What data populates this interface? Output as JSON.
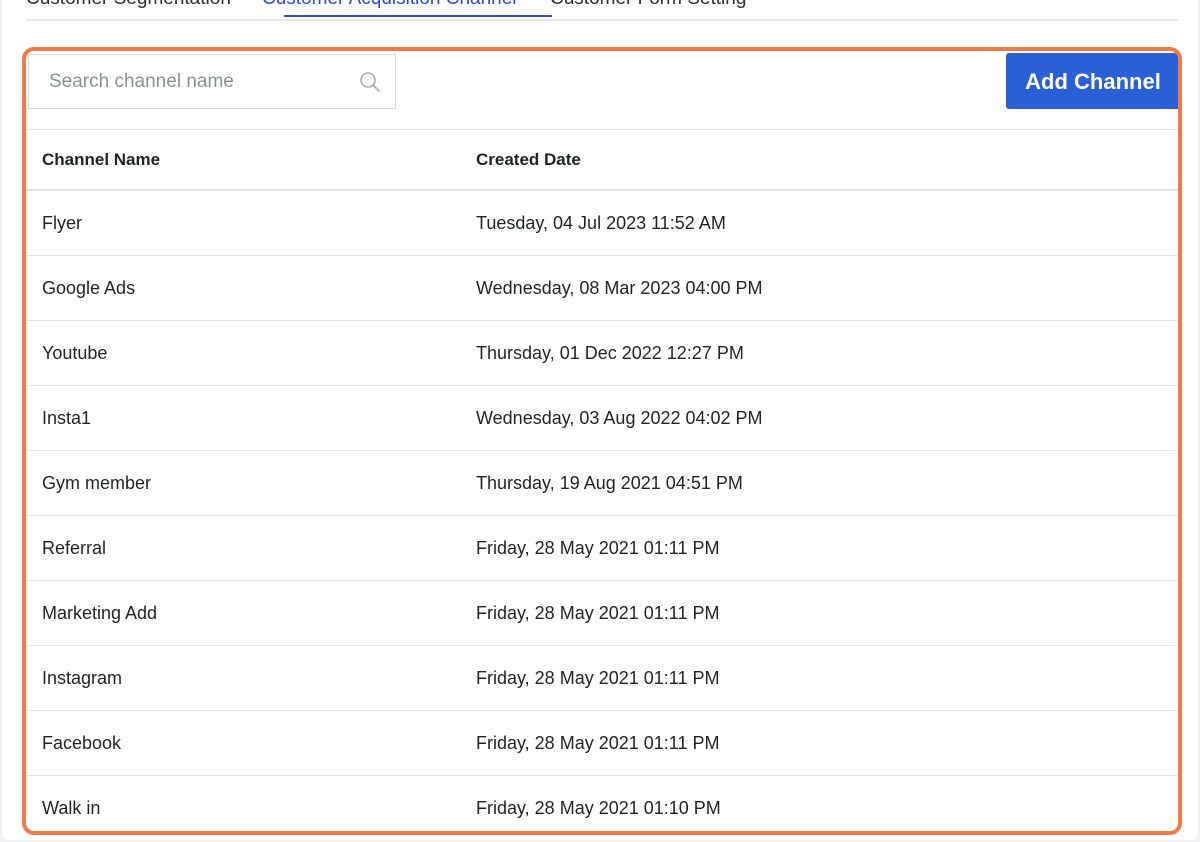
{
  "tabs": [
    {
      "label": "Customer Segmentation"
    },
    {
      "label": "Customer Acquisition Channel"
    },
    {
      "label": "Customer Form Setting"
    }
  ],
  "search": {
    "placeholder": "Search channel name",
    "value": ""
  },
  "toolbar": {
    "add_label": "Add Channel"
  },
  "table": {
    "headers": [
      "Channel Name",
      "Created Date"
    ],
    "rows": [
      {
        "name": "Flyer",
        "date": "Tuesday, 04 Jul 2023 11:52 AM"
      },
      {
        "name": "Google Ads",
        "date": "Wednesday, 08 Mar 2023 04:00 PM"
      },
      {
        "name": "Youtube",
        "date": "Thursday, 01 Dec 2022 12:27 PM"
      },
      {
        "name": "Insta1",
        "date": "Wednesday, 03 Aug 2022 04:02 PM"
      },
      {
        "name": "Gym member",
        "date": "Thursday, 19 Aug 2021 04:51 PM"
      },
      {
        "name": "Referral",
        "date": "Friday, 28 May 2021 01:11 PM"
      },
      {
        "name": "Marketing Add",
        "date": "Friday, 28 May 2021 01:11 PM"
      },
      {
        "name": "Instagram",
        "date": "Friday, 28 May 2021 01:11 PM"
      },
      {
        "name": "Facebook",
        "date": "Friday, 28 May 2021 01:11 PM"
      },
      {
        "name": "Walk in",
        "date": "Friday, 28 May 2021 01:10 PM"
      }
    ]
  },
  "colors": {
    "accent": "#2a5fd6",
    "active_tab": "#2a4bd4",
    "highlight_frame": "#f47a45"
  },
  "icons": {
    "search": "search-icon"
  }
}
